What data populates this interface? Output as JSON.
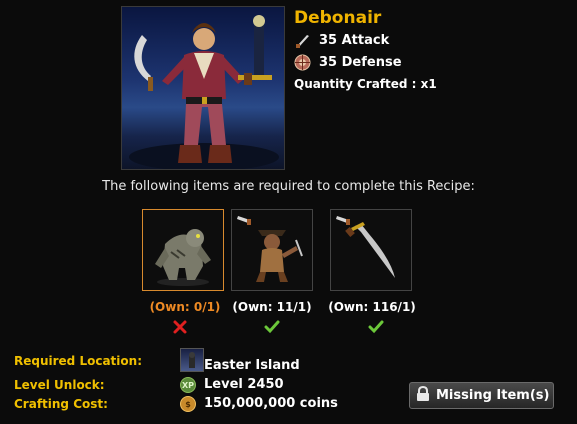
{
  "item": {
    "name": "Debonair",
    "attack_text": "35 Attack",
    "defense_text": "35 Defense",
    "quantity_text": "Quantity Crafted : x1"
  },
  "requirement_text": "The following items are required to complete this Recipe:",
  "ingredients": [
    {
      "icon": "beast-creature",
      "own_text": "(Own: 0/1)",
      "status": "missing"
    },
    {
      "icon": "pirate-monkey-with-cutlass",
      "own_text": "(Own: 11/1)",
      "status": "ok"
    },
    {
      "icon": "curved-sword",
      "own_text": "(Own: 116/1)",
      "status": "ok"
    }
  ],
  "info": {
    "location_label": "Required Location:",
    "location_value": "Easter Island",
    "level_label": "Level Unlock:",
    "level_value": "Level 2450",
    "cost_label": "Crafting Cost:",
    "cost_value": "150,000,000 coins",
    "xp_badge": "XP"
  },
  "missing_button": {
    "label": "Missing Item(s)"
  },
  "colors": {
    "title": "#f0b400",
    "label": "#f0c000",
    "missing": "#ee8a24",
    "ok": "#6cc83a",
    "fail": "#e02020"
  }
}
